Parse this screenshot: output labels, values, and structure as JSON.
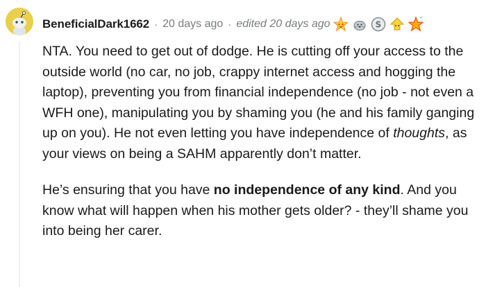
{
  "comment": {
    "author": "BeneficialDark1662",
    "separator": "·",
    "timestamp": "20 days ago",
    "edited": "edited 20 days ago",
    "awards": [
      "starstruck-award-icon",
      "wholesome-seal-award-icon",
      "silver-coin-award-icon",
      "helpful-award-icon",
      "star-award-icon"
    ],
    "paragraph1": {
      "part1": "NTA. You need to get out of dodge. He is cutting off your access to the outside world (no car, no job, crappy internet access and hogging the laptop), preventing you from financial independence (no job - not even a WFH one), manipulating you by shaming you (he and his family ganging up on you). He not even letting you have independence of ",
      "italic": "thoughts",
      "part2": ", as your views on being a SAHM apparently don’t matter."
    },
    "paragraph2": {
      "part1": "He’s ensuring that you have ",
      "bold": "no independence of any kind",
      "part2": ". And you know what will happen when his mother gets older? - they’ll shame you into being her carer."
    }
  },
  "colors": {
    "avatar_bg": "#e8d04a",
    "meta_text": "#787c7e",
    "body_text": "#1a1a1b",
    "thread_line": "#edeff1"
  }
}
